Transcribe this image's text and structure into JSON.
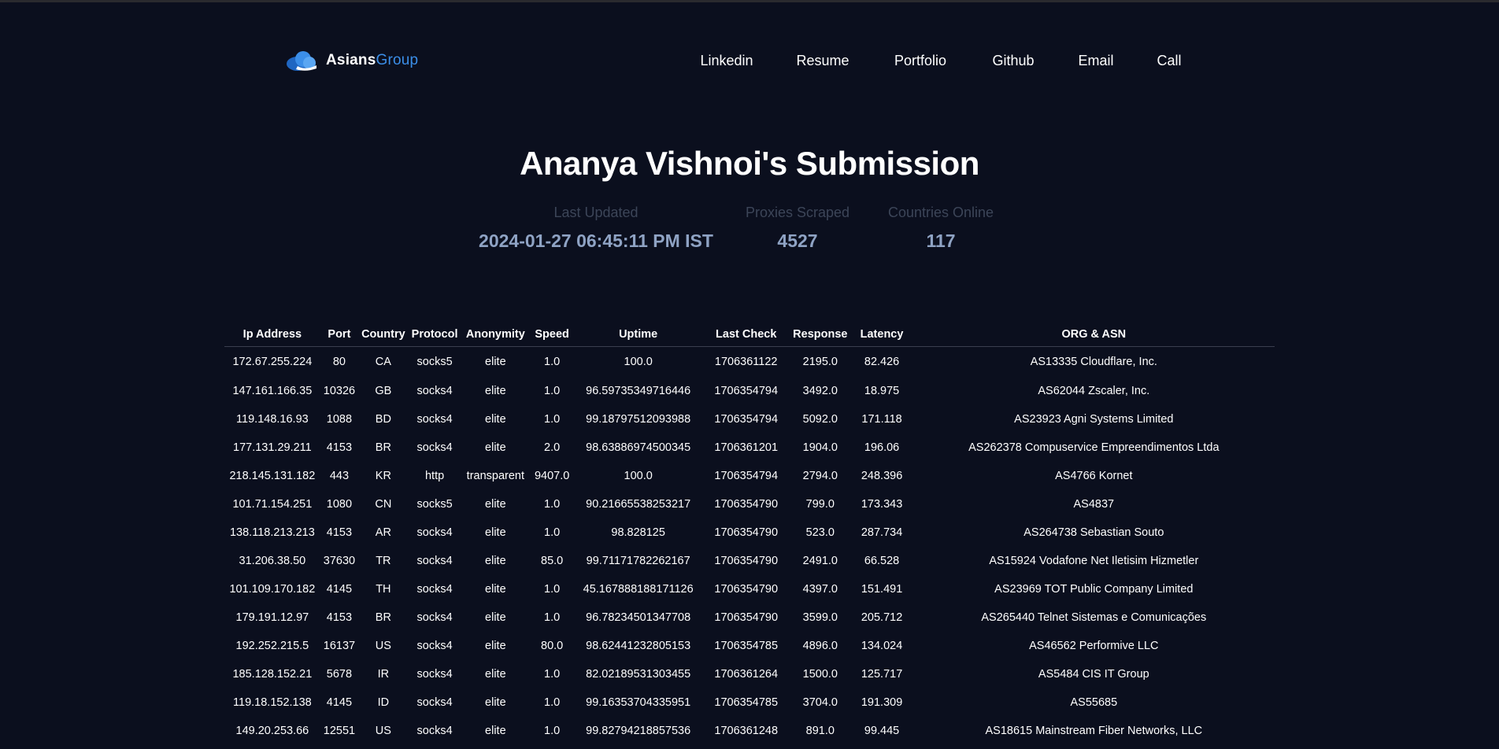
{
  "brand": {
    "name_part1": "Asians",
    "name_part2": "Group",
    "logo_icon": "cloud-icon",
    "accent": "#3b8ee8"
  },
  "nav": [
    "Linkedin",
    "Resume",
    "Portfolio",
    "Github",
    "Email",
    "Call"
  ],
  "title": "Ananya Vishnoi's Submission",
  "stats": [
    {
      "label": "Last Updated",
      "value": "2024-01-27 06:45:11 PM IST"
    },
    {
      "label": "Proxies Scraped",
      "value": "4527"
    },
    {
      "label": "Countries Online",
      "value": "117"
    }
  ],
  "table": {
    "headers": [
      "Ip Address",
      "Port",
      "Country",
      "Protocol",
      "Anonymity",
      "Speed",
      "Uptime",
      "Last Check",
      "Response",
      "Latency",
      "ORG & ASN"
    ],
    "rows": [
      [
        "172.67.255.224",
        "80",
        "CA",
        "socks5",
        "elite",
        "1.0",
        "100.0",
        "1706361122",
        "2195.0",
        "82.426",
        "AS13335 Cloudflare, Inc."
      ],
      [
        "147.161.166.35",
        "10326",
        "GB",
        "socks4",
        "elite",
        "1.0",
        "96.59735349716446",
        "1706354794",
        "3492.0",
        "18.975",
        "AS62044 Zscaler, Inc."
      ],
      [
        "119.148.16.93",
        "1088",
        "BD",
        "socks4",
        "elite",
        "1.0",
        "99.18797512093988",
        "1706354794",
        "5092.0",
        "171.118",
        "AS23923 Agni Systems Limited"
      ],
      [
        "177.131.29.211",
        "4153",
        "BR",
        "socks4",
        "elite",
        "2.0",
        "98.63886974500345",
        "1706361201",
        "1904.0",
        "196.06",
        "AS262378 Compuservice Empreendimentos Ltda"
      ],
      [
        "218.145.131.182",
        "443",
        "KR",
        "http",
        "transparent",
        "9407.0",
        "100.0",
        "1706354794",
        "2794.0",
        "248.396",
        "AS4766 Kornet"
      ],
      [
        "101.71.154.251",
        "1080",
        "CN",
        "socks5",
        "elite",
        "1.0",
        "90.21665538253217",
        "1706354790",
        "799.0",
        "173.343",
        "AS4837"
      ],
      [
        "138.118.213.213",
        "4153",
        "AR",
        "socks4",
        "elite",
        "1.0",
        "98.828125",
        "1706354790",
        "523.0",
        "287.734",
        "AS264738 Sebastian Souto"
      ],
      [
        "31.206.38.50",
        "37630",
        "TR",
        "socks4",
        "elite",
        "85.0",
        "99.71171782262167",
        "1706354790",
        "2491.0",
        "66.528",
        "AS15924 Vodafone Net Iletisim Hizmetler"
      ],
      [
        "101.109.170.182",
        "4145",
        "TH",
        "socks4",
        "elite",
        "1.0",
        "45.167888188171126",
        "1706354790",
        "4397.0",
        "151.491",
        "AS23969 TOT Public Company Limited"
      ],
      [
        "179.191.12.97",
        "4153",
        "BR",
        "socks4",
        "elite",
        "1.0",
        "96.78234501347708",
        "1706354790",
        "3599.0",
        "205.712",
        "AS265440 Telnet Sistemas e Comunicações"
      ],
      [
        "192.252.215.5",
        "16137",
        "US",
        "socks4",
        "elite",
        "80.0",
        "98.62441232805153",
        "1706354785",
        "4896.0",
        "134.024",
        "AS46562 Performive LLC"
      ],
      [
        "185.128.152.21",
        "5678",
        "IR",
        "socks4",
        "elite",
        "1.0",
        "82.02189531303455",
        "1706361264",
        "1500.0",
        "125.717",
        "AS5484 CIS IT Group"
      ],
      [
        "119.18.152.138",
        "4145",
        "ID",
        "socks4",
        "elite",
        "1.0",
        "99.16353704335951",
        "1706354785",
        "3704.0",
        "191.309",
        "AS55685"
      ],
      [
        "149.20.253.66",
        "12551",
        "US",
        "socks4",
        "elite",
        "1.0",
        "99.82794218857536",
        "1706361248",
        "891.0",
        "99.445",
        "AS18615 Mainstream Fiber Networks, LLC"
      ]
    ]
  }
}
